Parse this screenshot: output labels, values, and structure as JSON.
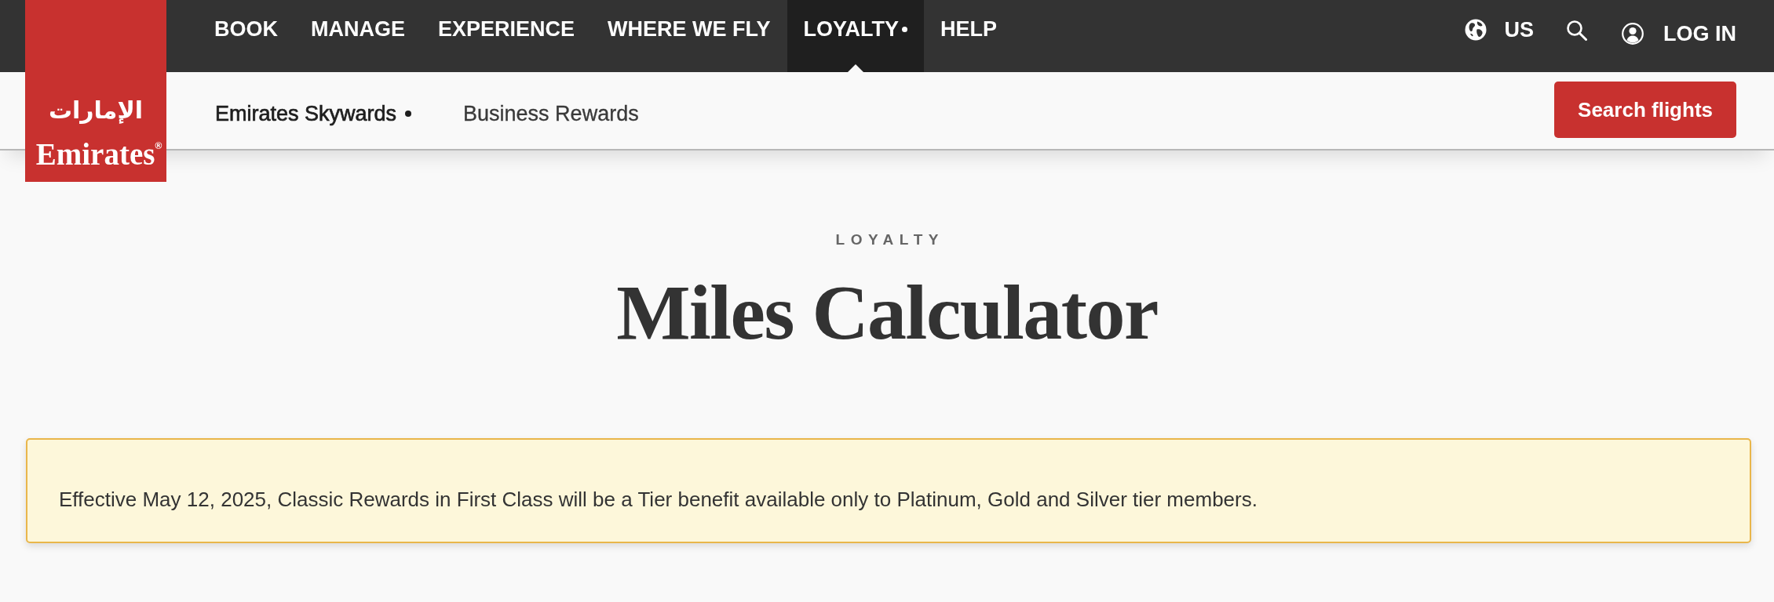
{
  "logo": {
    "arabic": "الإمارات",
    "wordmark": "Emirates$^{®}$"
  },
  "primary_nav": [
    {
      "label": "BOOK",
      "selected": false
    },
    {
      "label": "MANAGE",
      "selected": false
    },
    {
      "label": "EXPERIENCE",
      "selected": false
    },
    {
      "label": "WHERE WE FLY",
      "selected": false
    },
    {
      "label": "LOYALTY",
      "selected": true
    },
    {
      "label": "HELP",
      "selected": false
    }
  ],
  "utility_nav": {
    "region": "US",
    "login": "LOG IN"
  },
  "secondary_nav": [
    {
      "label": "Emirates Skywards",
      "selected": true
    },
    {
      "label": "Business Rewards",
      "selected": false
    }
  ],
  "search_button": "Search flights",
  "page": {
    "eyebrow": "LOYALTY",
    "title": "Miles Calculator"
  },
  "notice": "Effective May 12, 2025, Classic Rewards in First Class will be a Tier benefit available only to Platinum, Gold and Silver tier members."
}
